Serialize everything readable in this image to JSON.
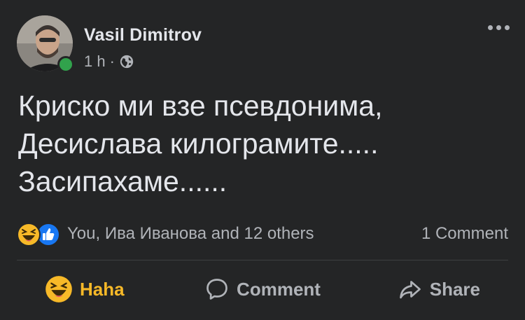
{
  "post": {
    "author": "Vasil Dimitrov",
    "time": "1 h",
    "separator": "·",
    "privacy_icon": "globe-icon",
    "more_icon": "more-horizontal-icon",
    "text_lines": [
      "Криско ми взе псевдонима,",
      "Десислава килограмите.....",
      "Засипахаме......"
    ]
  },
  "reactions": {
    "icons": [
      "haha-reaction-icon",
      "like-reaction-icon"
    ],
    "names": "You, Ива Иванова and 12 others",
    "comments": "1 Comment"
  },
  "actions": {
    "haha_label": "Haha",
    "comment_label": "Comment",
    "share_label": "Share"
  },
  "colors": {
    "background": "#242526",
    "primary_text": "#e4e6eb",
    "secondary_text": "#b0b3b8",
    "haha_yellow": "#f7b928",
    "like_blue": "#1877f2",
    "online_green": "#31a24c"
  }
}
